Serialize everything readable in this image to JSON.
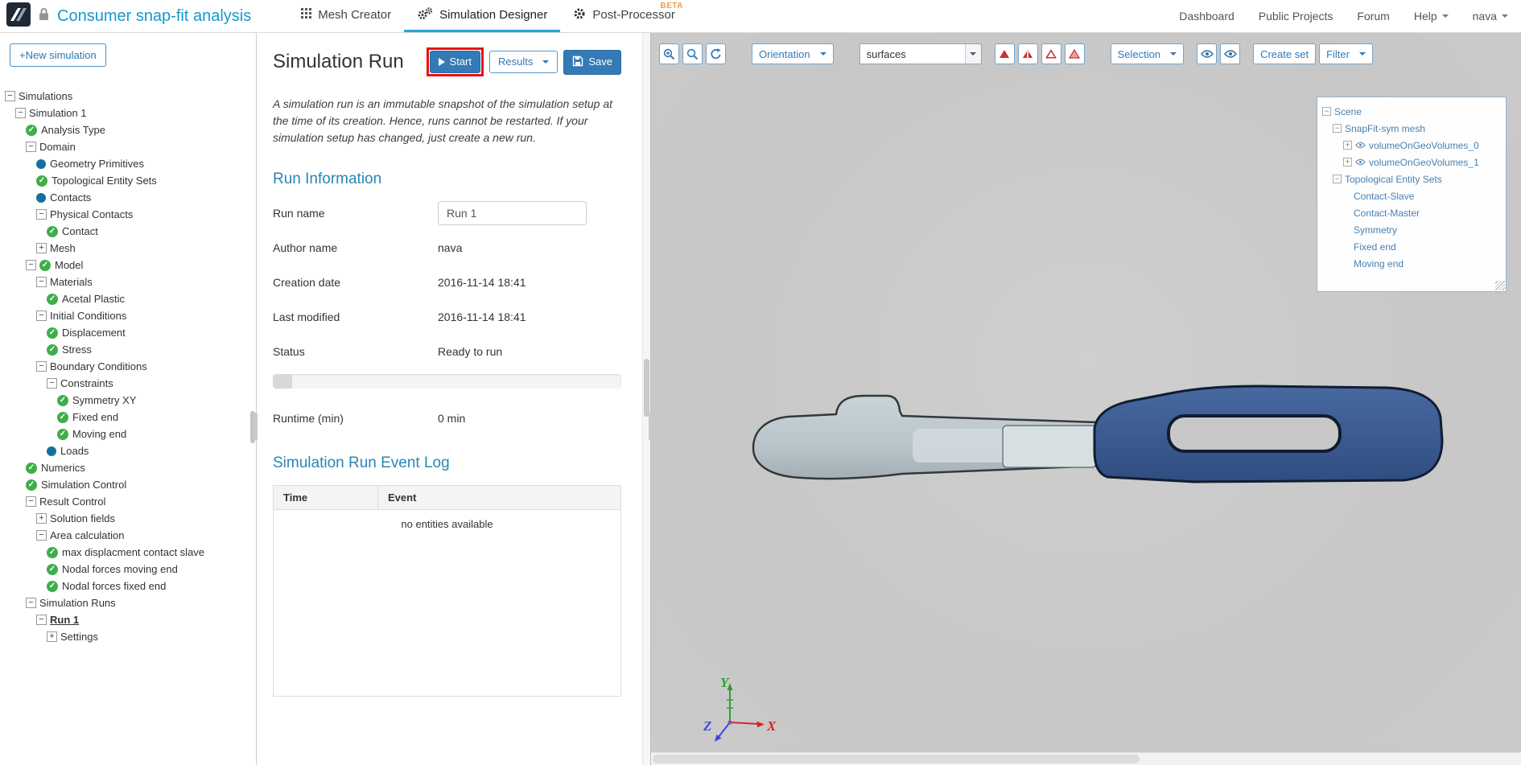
{
  "navbar": {
    "project_title": "Consumer snap-fit analysis",
    "tabs": [
      {
        "label": "Mesh Creator"
      },
      {
        "label": "Simulation Designer"
      },
      {
        "label": "Post-Processor",
        "badge": "BETA"
      }
    ],
    "links": [
      {
        "label": "Dashboard"
      },
      {
        "label": "Public Projects"
      },
      {
        "label": "Forum"
      },
      {
        "label": "Help",
        "caret": true
      },
      {
        "label": "nava",
        "caret": true
      }
    ]
  },
  "sidebar": {
    "new_simulation_button": "+New simulation",
    "tree": [
      {
        "label": "Simulations",
        "depth": 0,
        "expander": "minus"
      },
      {
        "label": "Simulation 1",
        "depth": 1,
        "expander": "minus"
      },
      {
        "label": "Analysis Type",
        "depth": 2,
        "status": "check"
      },
      {
        "label": "Domain",
        "depth": 2,
        "expander": "minus"
      },
      {
        "label": "Geometry Primitives",
        "depth": 3,
        "status": "dot"
      },
      {
        "label": "Topological Entity Sets",
        "depth": 3,
        "status": "check"
      },
      {
        "label": "Contacts",
        "depth": 3,
        "status": "dot"
      },
      {
        "label": "Physical Contacts",
        "depth": 3,
        "expander": "minus"
      },
      {
        "label": "Contact",
        "depth": 4,
        "status": "check"
      },
      {
        "label": "Mesh",
        "depth": 3,
        "expander": "plus"
      },
      {
        "label": "Model",
        "depth": 2,
        "expander": "minus",
        "status": "check"
      },
      {
        "label": "Materials",
        "depth": 3,
        "expander": "minus"
      },
      {
        "label": "Acetal Plastic",
        "depth": 4,
        "status": "check"
      },
      {
        "label": "Initial Conditions",
        "depth": 3,
        "expander": "minus"
      },
      {
        "label": "Displacement",
        "depth": 4,
        "status": "check"
      },
      {
        "label": "Stress",
        "depth": 4,
        "status": "check"
      },
      {
        "label": "Boundary Conditions",
        "depth": 3,
        "expander": "minus"
      },
      {
        "label": "Constraints",
        "depth": 4,
        "expander": "minus"
      },
      {
        "label": "Symmetry XY",
        "depth": 5,
        "status": "check"
      },
      {
        "label": "Fixed end",
        "depth": 5,
        "status": "check"
      },
      {
        "label": "Moving end",
        "depth": 5,
        "status": "check"
      },
      {
        "label": "Loads",
        "depth": 4,
        "status": "dot"
      },
      {
        "label": "Numerics",
        "depth": 2,
        "status": "check"
      },
      {
        "label": "Simulation Control",
        "depth": 2,
        "status": "check"
      },
      {
        "label": "Result Control",
        "depth": 2,
        "expander": "minus"
      },
      {
        "label": "Solution fields",
        "depth": 3,
        "expander": "plus"
      },
      {
        "label": "Area calculation",
        "depth": 3,
        "expander": "minus"
      },
      {
        "label": "max displacment contact slave",
        "depth": 4,
        "status": "check"
      },
      {
        "label": "Nodal forces moving end",
        "depth": 4,
        "status": "check"
      },
      {
        "label": "Nodal forces fixed end",
        "depth": 4,
        "status": "check"
      },
      {
        "label": "Simulation Runs",
        "depth": 2,
        "expander": "minus"
      },
      {
        "label": "Run 1",
        "depth": 3,
        "expander": "minus",
        "selected": true
      },
      {
        "label": "Settings",
        "depth": 4,
        "expander": "plus"
      }
    ]
  },
  "run_panel": {
    "title": "Simulation Run",
    "buttons": {
      "start": "Start",
      "results": "Results",
      "save": "Save"
    },
    "description": "A simulation run is an immutable snapshot of the simulation setup at the time of its creation. Hence, runs cannot be restarted. If your simulation setup has changed, just create a new run.",
    "run_information_heading": "Run Information",
    "run_name_field": {
      "label": "Run name",
      "value": "Run 1"
    },
    "info_fields": [
      {
        "label": "Author name",
        "value": "nava"
      },
      {
        "label": "Creation date",
        "value": "2016-11-14 18:41"
      },
      {
        "label": "Last modified",
        "value": "2016-11-14 18:41"
      },
      {
        "label": "Status",
        "value": "Ready to run"
      }
    ],
    "progress_percent": 0,
    "runtime_field": {
      "label": "Runtime (min)",
      "value": "0 min"
    },
    "event_log_heading": "Simulation Run Event Log",
    "event_table": {
      "columns": [
        "Time",
        "Event"
      ],
      "empty_message": "no entities available"
    }
  },
  "viewport": {
    "toolbar": {
      "orientation_button": "Orientation",
      "surfaces_select_value": "surfaces",
      "selection_button": "Selection",
      "create_set_button": "Create set",
      "filter_button": "Filter"
    },
    "scene_tree": [
      {
        "label": "Scene",
        "depth": 0,
        "expander": "minus"
      },
      {
        "label": "SnapFit-sym mesh",
        "depth": 1,
        "expander": "minus"
      },
      {
        "label": "volumeOnGeoVolumes_0",
        "depth": 2,
        "expander": "plus",
        "eye": true
      },
      {
        "label": "volumeOnGeoVolumes_1",
        "depth": 2,
        "expander": "plus",
        "eye": true
      },
      {
        "label": "Topological Entity Sets",
        "depth": 1,
        "expander": "minus"
      },
      {
        "label": "Contact-Slave",
        "depth": 3
      },
      {
        "label": "Contact-Master",
        "depth": 3
      },
      {
        "label": "Symmetry",
        "depth": 3
      },
      {
        "label": "Fixed end",
        "depth": 3
      },
      {
        "label": "Moving end",
        "depth": 3
      }
    ],
    "axis_labels": {
      "x": "X",
      "y": "Y",
      "z": "Z"
    }
  },
  "icons": {
    "brand": "app-logo",
    "lock": "lock-icon",
    "mesh_creator_tab": "grid-icon",
    "simulation_designer_tab": "gears-icon",
    "post_processor_tab": "gear-icon",
    "dropdown": "caret-down-icon",
    "start": "play-icon",
    "save": "floppy-icon",
    "zoom_in": "magnifier-plus-icon",
    "zoom_fit": "magnifier-icon",
    "refresh": "refresh-icon",
    "clip_planes": [
      "red-triangle-solid-icon",
      "red-triangle-stripe-icon",
      "red-triangle-outline-icon",
      "red-triangle-hatched-icon"
    ],
    "visibility": "eye-icon"
  }
}
